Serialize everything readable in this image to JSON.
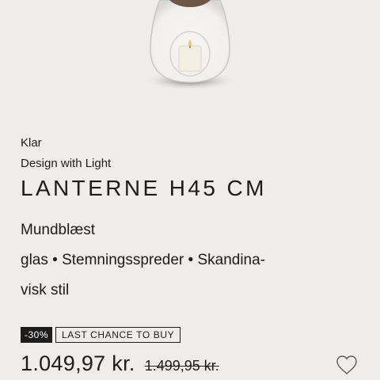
{
  "product": {
    "variant": "Klar",
    "collection": "Design with Light",
    "title": "LANTERNE H45 CM",
    "description_line1": "Mundblæst",
    "description_line2": "glas • Stemningsspreder • Skandina-",
    "description_line3": "visk stil"
  },
  "badges": {
    "discount": "-30%",
    "last_chance": "LAST CHANCE TO BUY"
  },
  "price": {
    "current": "1.049,97 kr.",
    "original": "1.499,95 kr."
  },
  "icons": {
    "wishlist": "heart-outline-icon"
  },
  "colors": {
    "background": "#efedeb",
    "text": "#1c1c1c",
    "badge_bg": "#1c1c1c"
  }
}
